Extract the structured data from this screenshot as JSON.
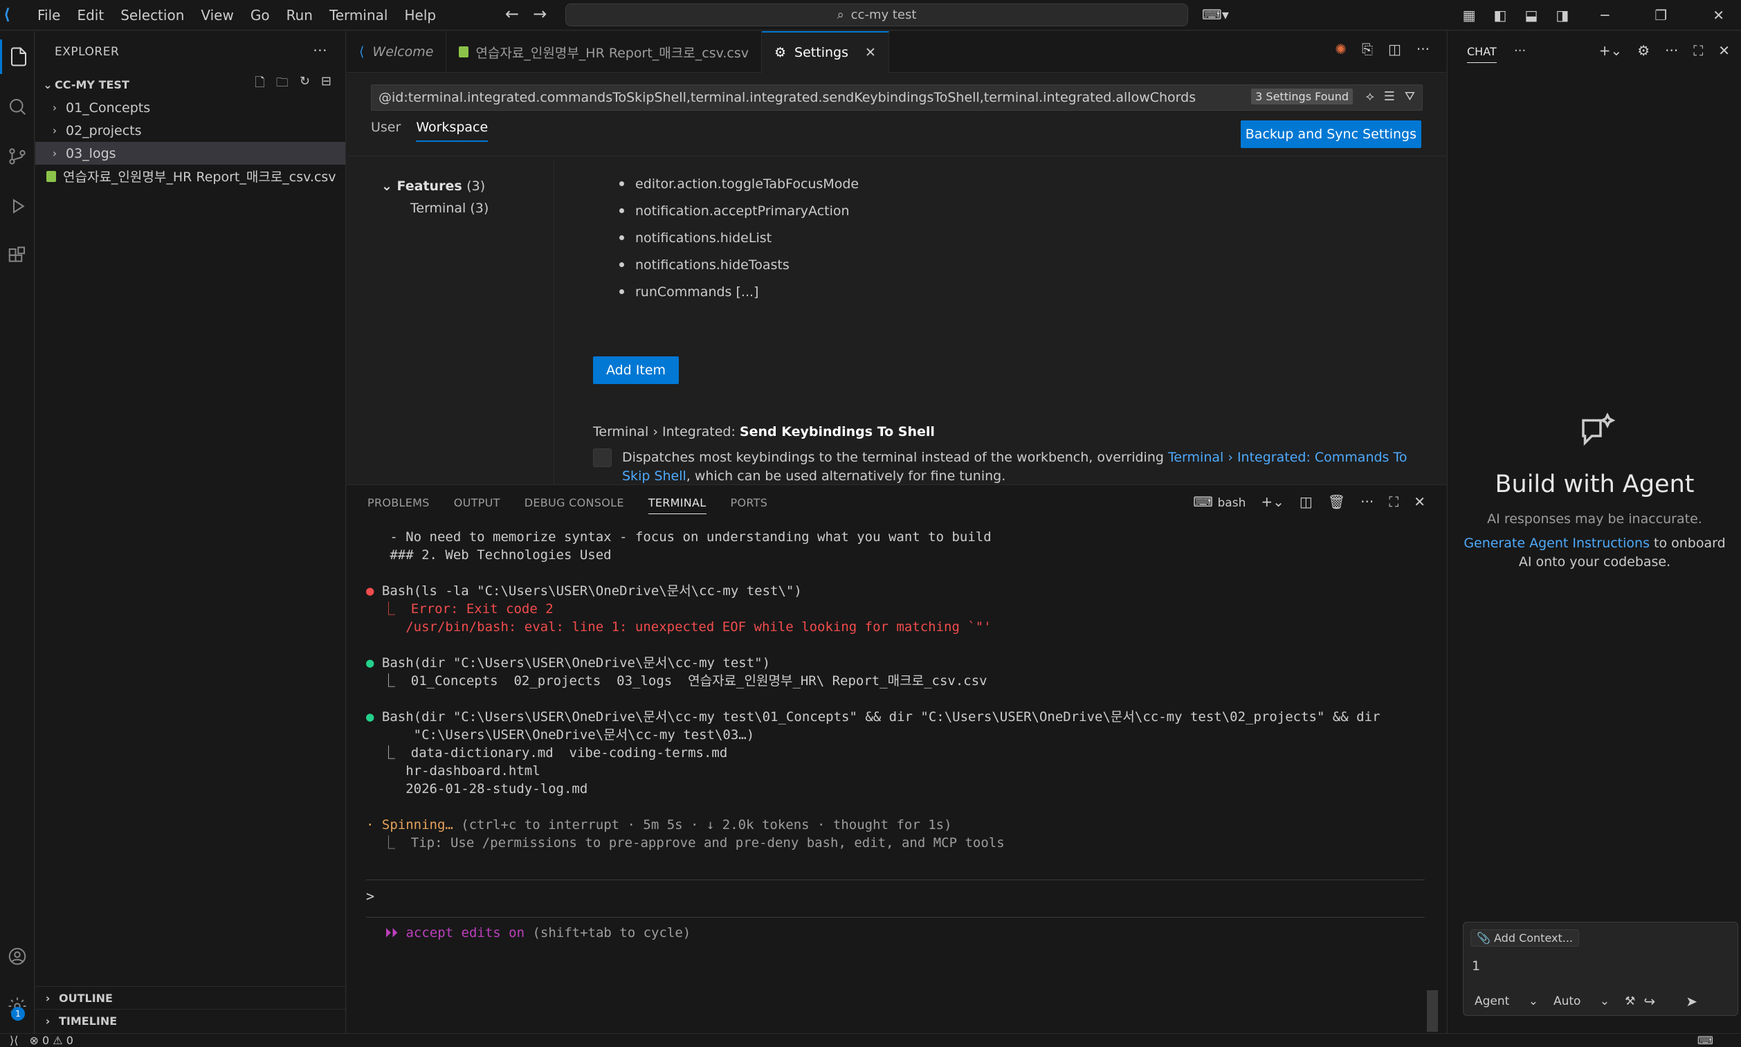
{
  "titlebar": {
    "menu": [
      "File",
      "Edit",
      "Selection",
      "View",
      "Go",
      "Run",
      "Terminal",
      "Help"
    ],
    "search_text": "cc-my test"
  },
  "explorer": {
    "title": "EXPLORER",
    "root": "CC-MY TEST",
    "folders": [
      "01_Concepts",
      "02_projects",
      "03_logs"
    ],
    "file": "연습자료_인원명부_HR Report_매크로_csv.csv",
    "outline": "OUTLINE",
    "timeline": "TIMELINE"
  },
  "tabs": [
    {
      "label": "Welcome"
    },
    {
      "label": "연습자료_인원명부_HR Report_매크로_csv.csv"
    },
    {
      "label": "Settings"
    }
  ],
  "settings": {
    "search_value": "@id:terminal.integrated.commandsToSkipShell,terminal.integrated.sendKeybindingsToShell,terminal.integrated.allowChords",
    "found": "3 Settings Found",
    "scope_user": "User",
    "scope_workspace": "Workspace",
    "backup_label": "Backup and Sync Settings",
    "toc_features": "Features",
    "toc_features_count": "(3)",
    "toc_terminal": "Terminal (3)",
    "list_items": [
      "editor.action.toggleTabFocusMode",
      "notification.acceptPrimaryAction",
      "notifications.hideList",
      "notifications.hideToasts",
      "runCommands [...]"
    ],
    "add_item": "Add Item",
    "setting_prefix": "Terminal › Integrated: ",
    "setting_name": "Send Keybindings To Shell",
    "desc_before": "Dispatches most keybindings to the terminal instead of the workbench, overriding ",
    "desc_link": "Terminal › Integrated: Commands To Skip Shell",
    "desc_after": ", which can be used alternatively for fine tuning."
  },
  "panel": {
    "tabs": [
      "PROBLEMS",
      "OUTPUT",
      "DEBUG CONSOLE",
      "TERMINAL",
      "PORTS"
    ],
    "shell": "bash"
  },
  "terminal": {
    "l1": "   - No need to memorize syntax - focus on understanding what you want to build",
    "l2": "   ### 2. Web Technologies Used",
    "l3_cmd": "Bash(ls -la \"C:\\Users\\USER\\OneDrive\\문서\\cc-my test\\\")",
    "l4": "  ⎿  Error: Exit code 2",
    "l5": "     /usr/bin/bash: eval: line 1: unexpected EOF while looking for matching `\"'",
    "l6_cmd": "Bash(dir \"C:\\Users\\USER\\OneDrive\\문서\\cc-my test\")",
    "l7": "  ⎿  01_Concepts  02_projects  03_logs  연습자료_인원명부_HR\\ Report_매크로_csv.csv",
    "l8_cmd": "Bash(dir \"C:\\Users\\USER\\OneDrive\\문서\\cc-my test\\01_Concepts\" && dir \"C:\\Users\\USER\\OneDrive\\문서\\cc-my test\\02_projects\" && dir",
    "l9": "      \"C:\\Users\\USER\\OneDrive\\문서\\cc-my test\\03…)",
    "l10": "  ⎿  data-dictionary.md  vibe-coding-terms.md",
    "l11": "     hr-dashboard.html",
    "l12": "     2026-01-28-study-log.md",
    "spin_word": "Spinning…",
    "spin_rest": " (ctrl+c to interrupt · 5m 5s · ↓ 2.0k tokens · thought for 1s)",
    "tip": "  ⎿  Tip: Use /permissions to pre-approve and pre-deny bash, edit, and MCP tools",
    "prompt": ">",
    "accept_label": "⏵⏵ accept edits on",
    "accept_rest": " (shift+tab to cycle)"
  },
  "chat": {
    "title": "CHAT",
    "heading": "Build with Agent",
    "disclaimer": "AI responses may be inaccurate.",
    "gen_link": "Generate Agent Instructions",
    "gen_rest": " to onboard AI onto your codebase.",
    "add_context": "Add Context...",
    "input_value": "1",
    "mode": "Agent",
    "model": "Auto"
  },
  "statusbar": {
    "errors": "0",
    "warnings": "0"
  },
  "colors": {
    "accent": "#0078d4",
    "link": "#4daafc",
    "error": "#f14c4c",
    "success": "#23d18b"
  }
}
